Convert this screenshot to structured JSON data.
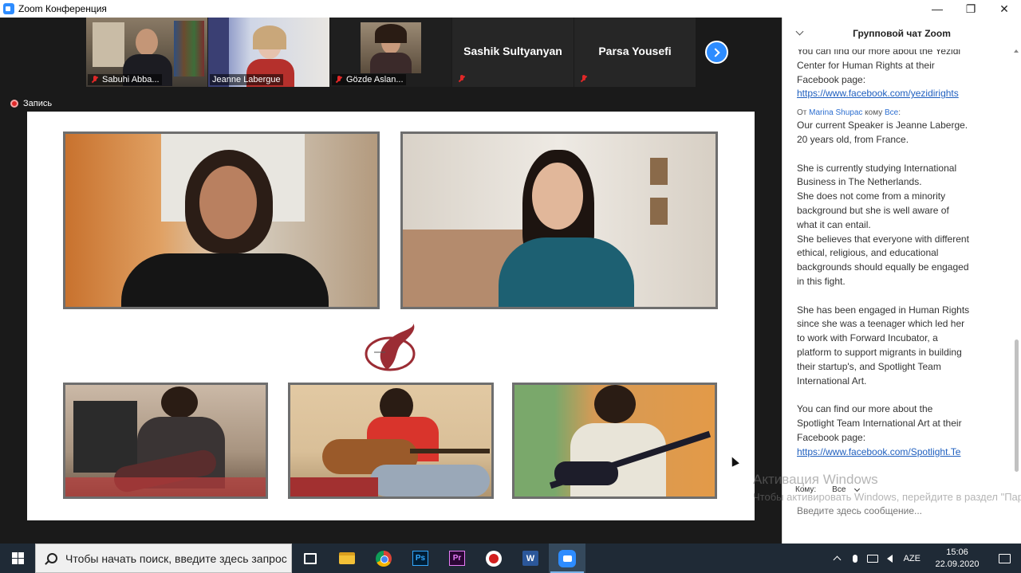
{
  "window": {
    "title": "Zoom Конференция",
    "minimize": "—",
    "maximize": "❐",
    "close": "✕"
  },
  "participants": [
    {
      "name": "Sabuhi Abba...",
      "video": true,
      "muted": true
    },
    {
      "name": "Jeanne Labergue",
      "video": true,
      "muted": false,
      "active_speaker": true
    },
    {
      "name": "Gözde Aslan...",
      "video": true,
      "muted": true
    },
    {
      "name": "Sashik Sultyanyan",
      "video": false,
      "muted": true
    },
    {
      "name": "Parsa Yousefi",
      "video": false,
      "muted": true
    }
  ],
  "recording": {
    "label": "Запись"
  },
  "chat": {
    "title": "Групповой чат Zoom",
    "messages": [
      {
        "text": "You can find our more about the Yezidi\nCenter for Human Rights at their\nFacebook page:",
        "link": "https://www.facebook.com/yezidirights"
      },
      {
        "from_prefix": "От ",
        "from": "Marina Shupac",
        "to_prefix": " кому ",
        "to": "Все",
        "suffix": ":",
        "text": "Our current Speaker is Jeanne Laberge.\n20 years old,  from France.\n\nShe is currently studying International\nBusiness in The Netherlands.\nShe does not come from a minority\nbackground but she is well aware of\nwhat it can entail.\nShe believes that everyone with different\nethical, religious, and educational\nbackgrounds should equally be engaged\nin this fight.\n\nShe has been engaged in Human Rights\nsince she was a teenager which led her\nto work with Forward Incubator, a\nplatform to support migrants in building\ntheir startup's, and  Spotlight Team\nInternational Art.\n\nYou can find our more about the\nSpotlight Team International Art at their\nFacebook page:",
        "link": "https://www.facebook.com/Spotlight.Te"
      }
    ],
    "to_label": "Кому:",
    "to_value": "Все",
    "input_placeholder": "Введите здесь сообщение..."
  },
  "watermark": {
    "line1": "Активация Windows",
    "line2": "Чтобы активировать Windows, перейдите в раздел \"Параметры\"."
  },
  "taskbar": {
    "search_placeholder": "Чтобы начать поиск, введите здесь запрос",
    "apps": [
      "task-view",
      "file-explorer",
      "chrome",
      "photoshop",
      "premiere",
      "screen-recorder",
      "word",
      "zoom"
    ],
    "ps_label": "Ps",
    "pr_label": "Pr",
    "word_label": "W",
    "lang": "AZE",
    "time": "15:06",
    "date": "22.09.2020"
  },
  "colors": {
    "zoom_blue": "#2d8cff",
    "mute_red": "#e02828",
    "active_speaker": "#b4d94f",
    "link": "#1f5fbf"
  }
}
